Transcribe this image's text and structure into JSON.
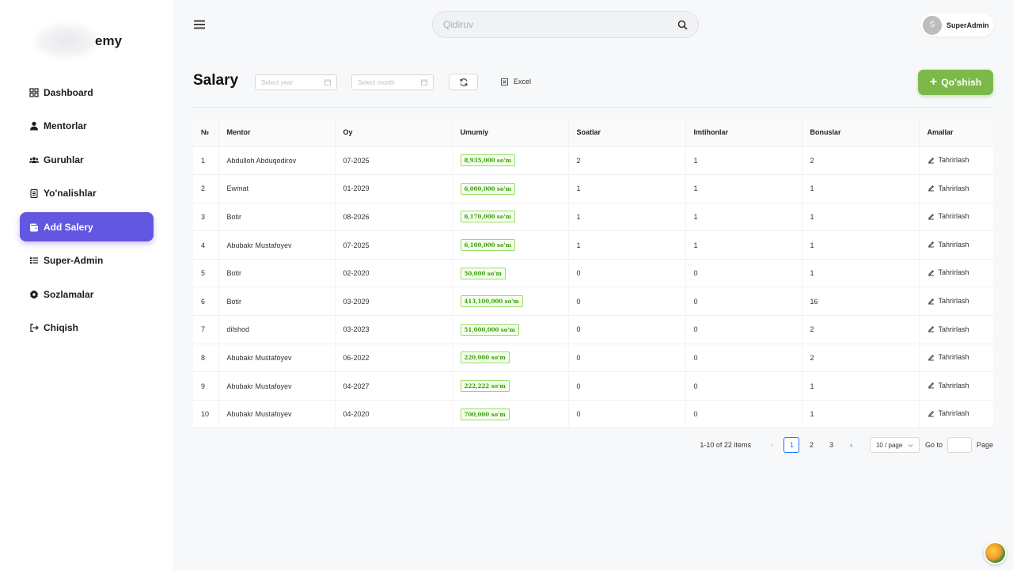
{
  "brand": {
    "logo_text": "emy"
  },
  "sidebar": {
    "items": [
      {
        "label": "Dashboard",
        "icon": "dashboard-icon"
      },
      {
        "label": "Mentorlar",
        "icon": "user-icon"
      },
      {
        "label": "Guruhlar",
        "icon": "group-icon"
      },
      {
        "label": "Yo'nalishlar",
        "icon": "clipboard-icon"
      },
      {
        "label": "Add Salery",
        "icon": "wallet-icon",
        "active": true
      },
      {
        "label": "Super-Admin",
        "icon": "list-icon"
      },
      {
        "label": "Sozlamalar",
        "icon": "gear-icon"
      },
      {
        "label": "Chiqish",
        "icon": "logout-icon"
      }
    ]
  },
  "header": {
    "search_placeholder": "Qidiruv",
    "user": {
      "initial": "S",
      "name": "SuperAdmin"
    }
  },
  "page": {
    "title": "Salary",
    "year_placeholder": "Select year",
    "month_placeholder": "Select month",
    "excel_label": "Excel",
    "add_label": "Qo'shish"
  },
  "table": {
    "columns": [
      "№",
      "Mentor",
      "Oy",
      "Umumiy",
      "Soatlar",
      "Imtihonlar",
      "Bonuslar",
      "Amallar"
    ],
    "edit_label": "Tahrirlash",
    "rows": [
      {
        "n": "1",
        "mentor": "Abdulloh Abduqodirov",
        "oy": "07-2025",
        "umumiy": "8,935,000 so'm",
        "soatlar": "2",
        "imtihonlar": "1",
        "bonuslar": "2"
      },
      {
        "n": "2",
        "mentor": "Ewmat",
        "oy": "01-2029",
        "umumiy": "6,000,000 so'm",
        "soatlar": "1",
        "imtihonlar": "1",
        "bonuslar": "1"
      },
      {
        "n": "3",
        "mentor": "Botir",
        "oy": "08-2026",
        "umumiy": "6,170,000 so'm",
        "soatlar": "1",
        "imtihonlar": "1",
        "bonuslar": "1"
      },
      {
        "n": "4",
        "mentor": "Abubakr Mustafoyev",
        "oy": "07-2025",
        "umumiy": "6,100,000 so'm",
        "soatlar": "1",
        "imtihonlar": "1",
        "bonuslar": "1"
      },
      {
        "n": "5",
        "mentor": "Botir",
        "oy": "02-2020",
        "umumiy": "50,000 so'm",
        "soatlar": "0",
        "imtihonlar": "0",
        "bonuslar": "1"
      },
      {
        "n": "6",
        "mentor": "Botir",
        "oy": "03-2029",
        "umumiy": "413,100,000 so'm",
        "soatlar": "0",
        "imtihonlar": "0",
        "bonuslar": "16"
      },
      {
        "n": "7",
        "mentor": "dilshod",
        "oy": "03-2023",
        "umumiy": "51,000,000 so'm",
        "soatlar": "0",
        "imtihonlar": "0",
        "bonuslar": "2"
      },
      {
        "n": "8",
        "mentor": "Abubakr Mustafoyev",
        "oy": "06-2022",
        "umumiy": "220,000 so'm",
        "soatlar": "0",
        "imtihonlar": "0",
        "bonuslar": "2"
      },
      {
        "n": "9",
        "mentor": "Abubakr Mustafoyev",
        "oy": "04-2027",
        "umumiy": "222,222 so'm",
        "soatlar": "0",
        "imtihonlar": "0",
        "bonuslar": "1"
      },
      {
        "n": "10",
        "mentor": "Abubakr Mustafoyev",
        "oy": "04-2020",
        "umumiy": "700,000 so'm",
        "soatlar": "0",
        "imtihonlar": "0",
        "bonuslar": "1"
      }
    ]
  },
  "pagination": {
    "total_text": "1-10 of 22 items",
    "pages": [
      "1",
      "2",
      "3"
    ],
    "current": "1",
    "prev": "‹",
    "next": "›",
    "page_size": "10 / page",
    "goto_label": "Go to",
    "page_label": "Page"
  }
}
